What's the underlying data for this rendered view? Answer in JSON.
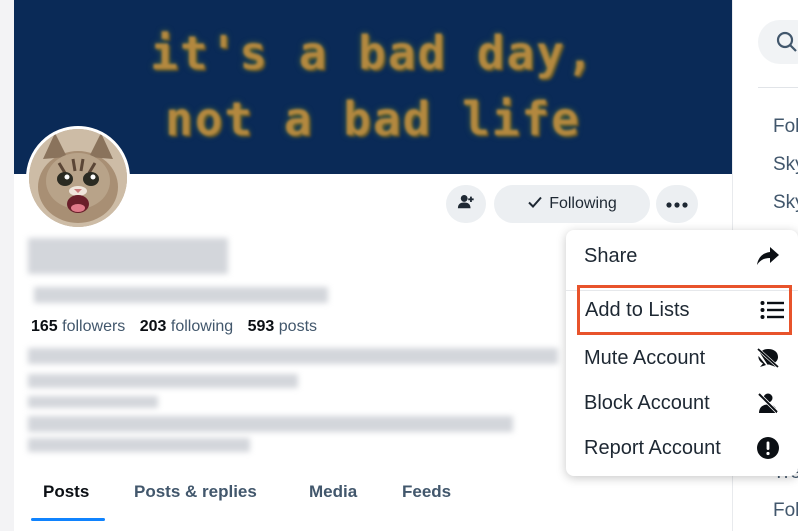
{
  "banner": {
    "line1": "it's a bad day,",
    "line2": "not a bad life"
  },
  "profile_actions": {
    "following_label": "Following"
  },
  "stats": {
    "followers_count": "165",
    "followers_label": "followers",
    "following_count": "203",
    "following_label": "following",
    "posts_count": "593",
    "posts_label": "posts"
  },
  "tabs": [
    {
      "label": "Posts",
      "active": true
    },
    {
      "label": "Posts & replies",
      "active": false
    },
    {
      "label": "Media",
      "active": false
    },
    {
      "label": "Feeds",
      "active": false
    }
  ],
  "menu": {
    "items": [
      {
        "label": "Share",
        "icon": "share-arrow-icon"
      },
      {
        "label": "Add to Lists",
        "icon": "list-icon"
      },
      {
        "label": "Mute Account",
        "icon": "mute-speech-icon"
      },
      {
        "label": "Block Account",
        "icon": "block-person-icon"
      },
      {
        "label": "Report Account",
        "icon": "alert-circle-icon"
      }
    ]
  },
  "right_column": {
    "items": [
      "Fol",
      "Sky",
      "Sky",
      "Tre",
      "Fol"
    ]
  },
  "colors": {
    "banner_bg": "#0a2a57",
    "highlight": "#e8532b",
    "active_tab_underline": "#1083fe"
  }
}
